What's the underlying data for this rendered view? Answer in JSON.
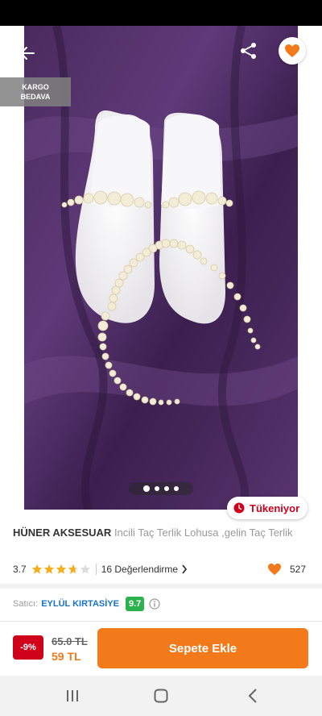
{
  "product": {
    "brand": "HÜNER AKSESUAR",
    "name": "Incili Taç Terlik Lohusa ,gelin Taç Terlik",
    "image_count": 4,
    "active_image": 1
  },
  "badges": {
    "cargo_line1": "KARGO",
    "cargo_line2": "BEDAVA",
    "stock_label": "Tükeniyor"
  },
  "rating": {
    "score": "3.7",
    "stars_value": 3.7,
    "stars_max": 5,
    "reviews_label": "16 Değerlendirme",
    "favorites": "527"
  },
  "seller": {
    "label": "Satıcı:",
    "name": "EYLÜL KIRTASİYE",
    "score": "9.7"
  },
  "price": {
    "discount": "-9%",
    "old": "65.0 TL",
    "new": "59 TL"
  },
  "actions": {
    "add_to_cart": "Sepete Ekle"
  },
  "icons": {
    "back": "back-arrow-icon",
    "share": "share-icon",
    "favorite": "heart-icon",
    "stock": "clock-icon",
    "info": "info-icon",
    "chevron": "chevron-right-icon"
  },
  "colors": {
    "brand_orange": "#f27a1a",
    "discount_red": "#d0021b",
    "seller_blue": "#1a73c7",
    "score_green": "#2bb24c",
    "star_gold": "#f2b01e"
  }
}
